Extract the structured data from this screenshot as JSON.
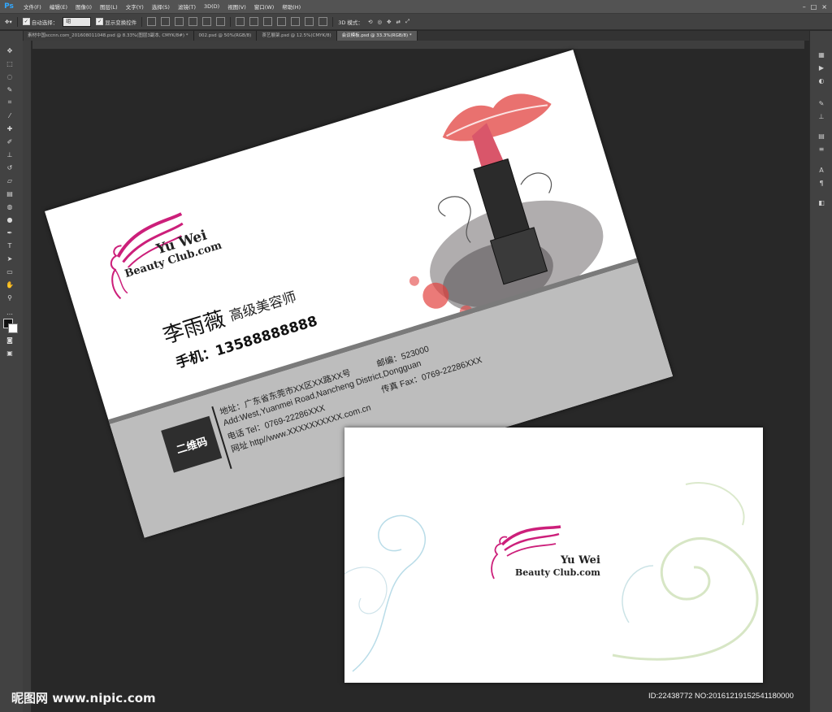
{
  "app": {
    "name": "Ps"
  },
  "menu": [
    "文件(F)",
    "编辑(E)",
    "图像(I)",
    "图层(L)",
    "文字(Y)",
    "选择(S)",
    "滤镜(T)",
    "3D(D)",
    "视图(V)",
    "窗口(W)",
    "帮助(H)"
  ],
  "options": {
    "auto_select_label": "自动选择：",
    "auto_select_value": "组",
    "show_transform_label": "显示变换控件",
    "mode_label": "3D 模式："
  },
  "tabs": [
    {
      "label": "素材中国sccnn.com_20160801104​8.psd @ 8.33%(图层3副本, CMYK/8#) *",
      "active": false
    },
    {
      "label": "002.psd @ 50%(RGB/8)",
      "active": false
    },
    {
      "label": "茶艺展架.psd @ 12.5%(CMYK/8)",
      "active": false
    },
    {
      "label": "会议模板.psd @ 33.3%(RGB/8) *",
      "active": true
    }
  ],
  "card_front": {
    "brand_top": "Yu Wei",
    "brand_bottom": "Beauty Club.com",
    "name": "李雨薇",
    "title": "高级美容师",
    "phone": "手机：13588888888",
    "qr_label": "二维码",
    "address_cn": "地址：广东省东莞市XX区XX路XX号",
    "postcode": "邮编：523000",
    "address_en": "Add:West,Yuanmei Road,Nancheng District,Dongguan",
    "phone_tel": "电话 Tel：0769-22286XXX",
    "fax": "传真 Fax：0769-22286XXX",
    "website": "网址 http//www.XXXXXXXXXX.com.cn"
  },
  "card_back": {
    "brand_top": "Yu Wei",
    "brand_bottom": "Beauty Club.com"
  },
  "colors": {
    "accent": "#cc1f7a",
    "lips": "#e2413f",
    "grey_band": "#bdbdbd",
    "qr_bg": "#2e2e2e"
  },
  "watermark": "昵图网 www.nipic.com",
  "image_id": "ID:22438772 NO:20161219152541180000"
}
